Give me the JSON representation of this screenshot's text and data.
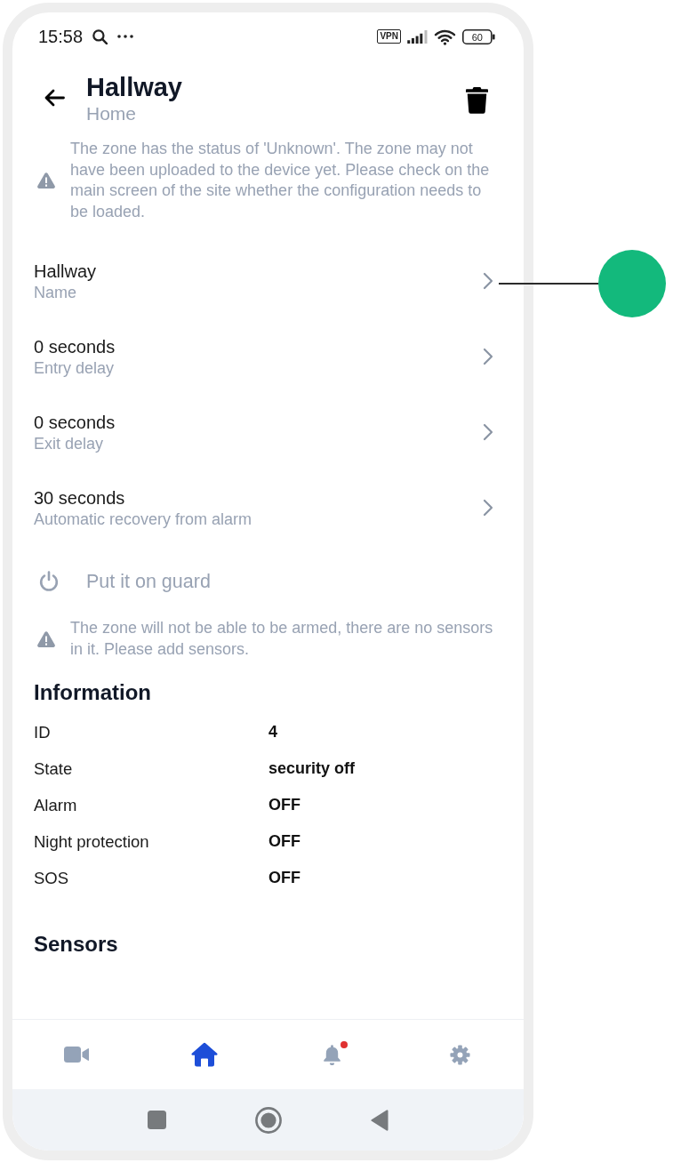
{
  "status_bar": {
    "time": "15:58",
    "vpn": "VPN",
    "battery": "60"
  },
  "header": {
    "title": "Hallway",
    "subtitle": "Home"
  },
  "zone_notice": "The zone has the status of 'Unknown'. The zone may not have been uploaded to the device yet. Please check on the main screen of the site whether the configuration needs to be loaded.",
  "settings": [
    {
      "value": "Hallway",
      "label": "Name",
      "callout": true
    },
    {
      "value": "0 seconds",
      "label": "Entry delay",
      "callout": false
    },
    {
      "value": "0 seconds",
      "label": "Exit delay",
      "callout": false
    },
    {
      "value": "30 seconds",
      "label": "Automatic recovery from alarm",
      "callout": false
    }
  ],
  "guard_action": {
    "label": "Put it on guard",
    "disabled": true
  },
  "guard_notice": "The zone will not be able to be armed, there are no sensors in it. Please add sensors.",
  "information": {
    "title": "Information",
    "rows": [
      {
        "label": "ID",
        "value": "4"
      },
      {
        "label": "State",
        "value": "security off"
      },
      {
        "label": "Alarm",
        "value": "OFF"
      },
      {
        "label": "Night protection",
        "value": "OFF"
      },
      {
        "label": "SOS",
        "value": "OFF"
      }
    ]
  },
  "sensors": {
    "title": "Sensors"
  },
  "bottom_nav": [
    {
      "kind": "camera",
      "selected": false,
      "notification": false
    },
    {
      "kind": "home",
      "selected": true,
      "notification": false
    },
    {
      "kind": "bell",
      "selected": false,
      "notification": true
    },
    {
      "kind": "gear",
      "selected": false,
      "notification": false
    }
  ],
  "system_nav": [
    {
      "kind": "recents"
    },
    {
      "kind": "home"
    },
    {
      "kind": "back"
    }
  ]
}
